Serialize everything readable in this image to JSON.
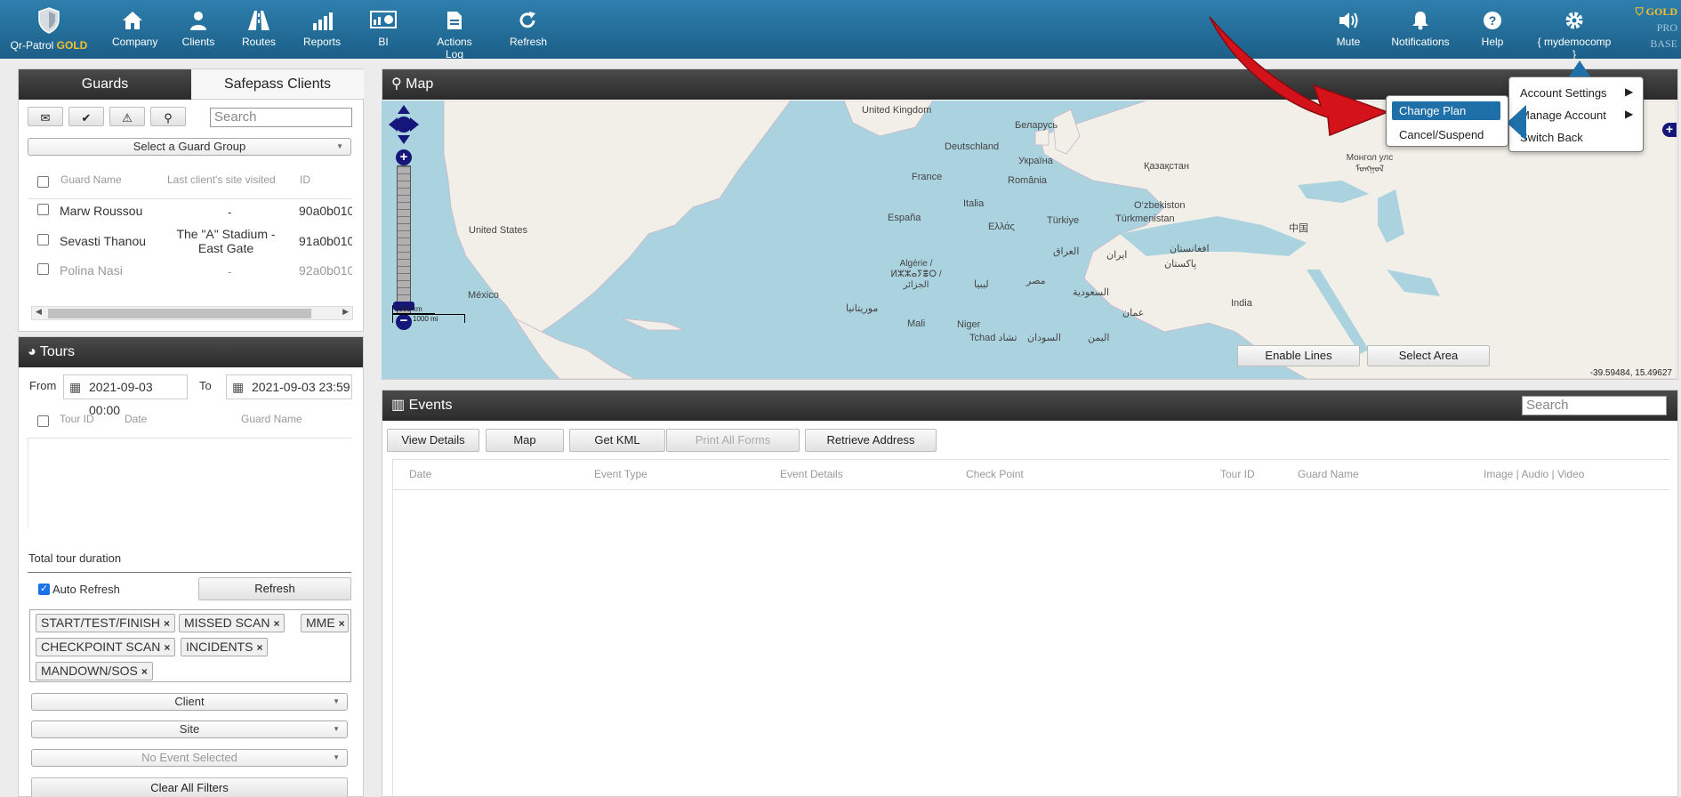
{
  "brand": {
    "name": "Qr-Patrol",
    "tier": "GOLD"
  },
  "nav": {
    "company": "Company",
    "clients": "Clients",
    "routes": "Routes",
    "reports": "Reports",
    "bi": "BI",
    "actions_log": "Actions Log",
    "refresh": "Refresh",
    "mute": "Mute",
    "notifications": "Notifications",
    "help": "Help",
    "account": "{ mydemocomp }"
  },
  "tiers": {
    "gold": "GOLD",
    "pro": "PRO",
    "base": "BASE"
  },
  "guards": {
    "tab_guards": "Guards",
    "tab_safepass": "Safepass Clients",
    "search_placeholder": "Search",
    "group_select": "Select a Guard Group",
    "headers": {
      "name": "Guard Name",
      "last_site": "Last client's site visited",
      "id": "ID"
    },
    "rows": [
      {
        "name": "Marw Roussou",
        "site": "-",
        "id": "90a0b010"
      },
      {
        "name": "Sevasti Thanou",
        "site": "The \"A\" Stadium - East Gate",
        "id": "91a0b010"
      },
      {
        "name": "Polina Nasi",
        "site": "-",
        "id": "92a0b010"
      }
    ]
  },
  "tours": {
    "title": "Tours",
    "from_label": "From",
    "from_value": "2021-09-03 00:00",
    "to_label": "To",
    "to_value": "2021-09-03 23:59",
    "headers": {
      "tour_id": "Tour ID",
      "date": "Date",
      "guard_name": "Guard Name"
    },
    "total_duration": "Total tour duration",
    "auto_refresh": "Auto Refresh",
    "refresh_button": "Refresh",
    "tags": [
      "START/TEST/FINISH",
      "MISSED SCAN",
      "MME",
      "CHECKPOINT SCAN",
      "INCIDENTS",
      "MANDOWN/SOS"
    ],
    "client_select": "Client",
    "site_select": "Site",
    "event_select": "No Event Selected",
    "clear_filters": "Clear All Filters"
  },
  "map": {
    "title": "Map",
    "enable_lines": "Enable Lines",
    "select_area": "Select Area",
    "coords": "-39.59484, 15.49627",
    "scale_km": "1000 km",
    "scale_mi": "1000 mi",
    "labels": {
      "uk": "United Kingdom",
      "belarus": "Беларусь",
      "ukraine": "Україна",
      "germany": "Deutschland",
      "france": "France",
      "romania": "România",
      "kazakhstan": "Қазақстан",
      "mongolia": "Монгол улс ᠮᠣᠩᠭᠣᠯ",
      "spain": "España",
      "italy": "Italia",
      "turkey": "Türkiye",
      "greece": "Ελλάς",
      "uzbekistan": "O‘zbekiston",
      "turkmenistan": "Türkmenistan",
      "china": "中国",
      "usa": "United States",
      "mexico": "México",
      "algeria": "Algérie / ⵍⵣⵣⴰⵢⴻⵔ / الجزائر",
      "iraq": "العراق",
      "iran": "ایران",
      "afghanistan": "افغانستان",
      "pakistan": "پاکستان",
      "libya": "ليبيا",
      "egypt": "مصر",
      "saudi": "السعودية",
      "mauritania": "موريتانيا",
      "oman": "عمان",
      "india": "India",
      "mali": "Mali",
      "niger": "Niger",
      "chad": "Tchad تشاد",
      "sudan": "السودان",
      "yemen": "اليمن"
    }
  },
  "events": {
    "title": "Events",
    "search_placeholder": "Search",
    "buttons": {
      "view_details": "View Details",
      "map": "Map",
      "get_kml": "Get KML",
      "print_forms": "Print All Forms",
      "retrieve_address": "Retrieve Address"
    },
    "headers": {
      "date": "Date",
      "event_type": "Event Type",
      "event_details": "Event Details",
      "check_point": "Check Point",
      "tour_id": "Tour ID",
      "guard_name": "Guard Name",
      "media": "Image | Audio | Video"
    }
  },
  "account_menu": {
    "settings": "Account Settings",
    "manage": "Manage Account",
    "switch_back": "Switch Back"
  },
  "sub_menu": {
    "change_plan": "Change Plan",
    "cancel": "Cancel/Suspend"
  },
  "colors": {
    "accent": "#1f6fa8",
    "gold": "#f4c12a",
    "arrow": "#d4121a"
  }
}
